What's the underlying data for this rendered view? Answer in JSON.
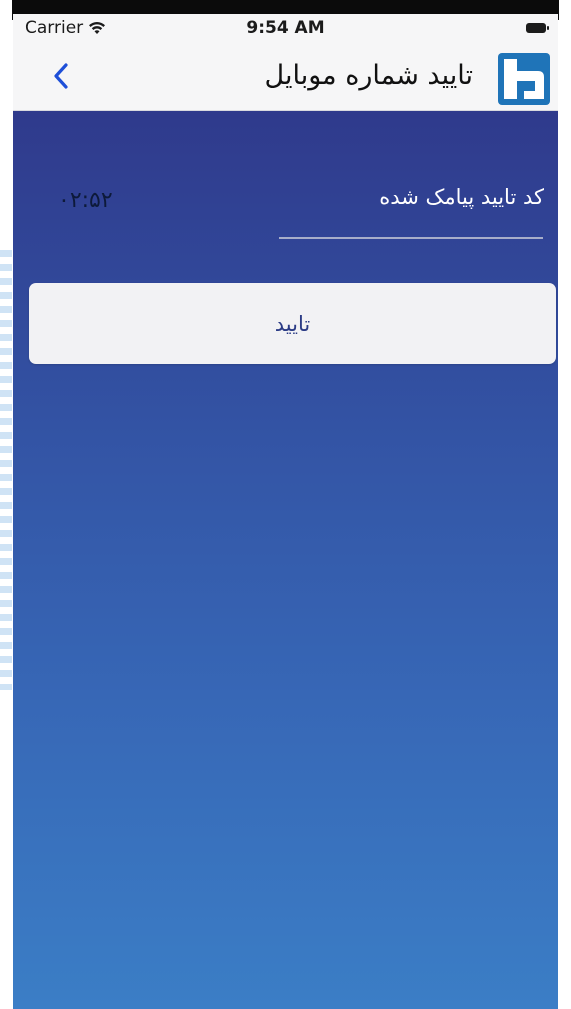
{
  "status_bar": {
    "carrier": "Carrier",
    "time": "9:54 AM",
    "icons": {
      "wifi": "wifi-icon",
      "battery": "battery-icon"
    }
  },
  "nav_bar": {
    "title": "تایید شماره موبایل",
    "back_icon": "chevron-left-icon",
    "logo_icon": "bank-logo-icon"
  },
  "form": {
    "code_label": "کد تایید پیامک شده",
    "code_value": "",
    "timer": "۰۲:۵۲",
    "submit_label": "تایید"
  },
  "colors": {
    "content_gradient_top": "#2f3a8c",
    "content_gradient_bottom": "#3b7ec6",
    "button_background": "#f2f2f4",
    "button_text": "#2c3c86",
    "logo_blue": "#1f74b8"
  }
}
